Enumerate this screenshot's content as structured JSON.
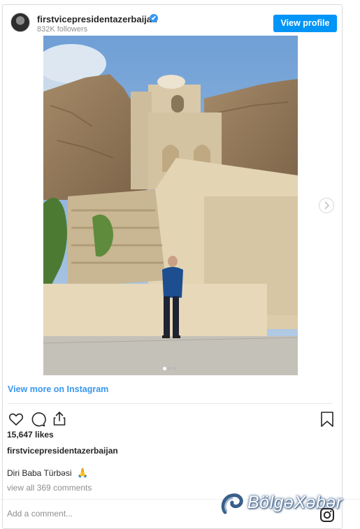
{
  "header": {
    "username": "firstvicepresidentazerbaijan",
    "verified_badge": "✔",
    "followers": "832K followers",
    "view_profile_label": "View profile"
  },
  "post": {
    "image_alt": "",
    "carousel_dots": 3,
    "active_dot": 0,
    "view_more_label": "View more on Instagram",
    "likes": "15,647 likes",
    "caption_user": "firstvicepresidentazerbaijan",
    "caption_text": "Diri Baba Türbəsi",
    "caption_emoji": "🙏",
    "comments_link": "view all 369 comments",
    "add_comment_placeholder": "Add a comment..."
  },
  "actions": {
    "icons": [
      "heart-icon",
      "comment-icon",
      "share-icon",
      "bookmark-icon"
    ]
  },
  "watermark": {
    "text": "BölgəXəbər"
  },
  "colors": {
    "accent": "#0095f6",
    "link": "#3897f0",
    "text": "#262626",
    "muted": "#8e8e8e"
  }
}
